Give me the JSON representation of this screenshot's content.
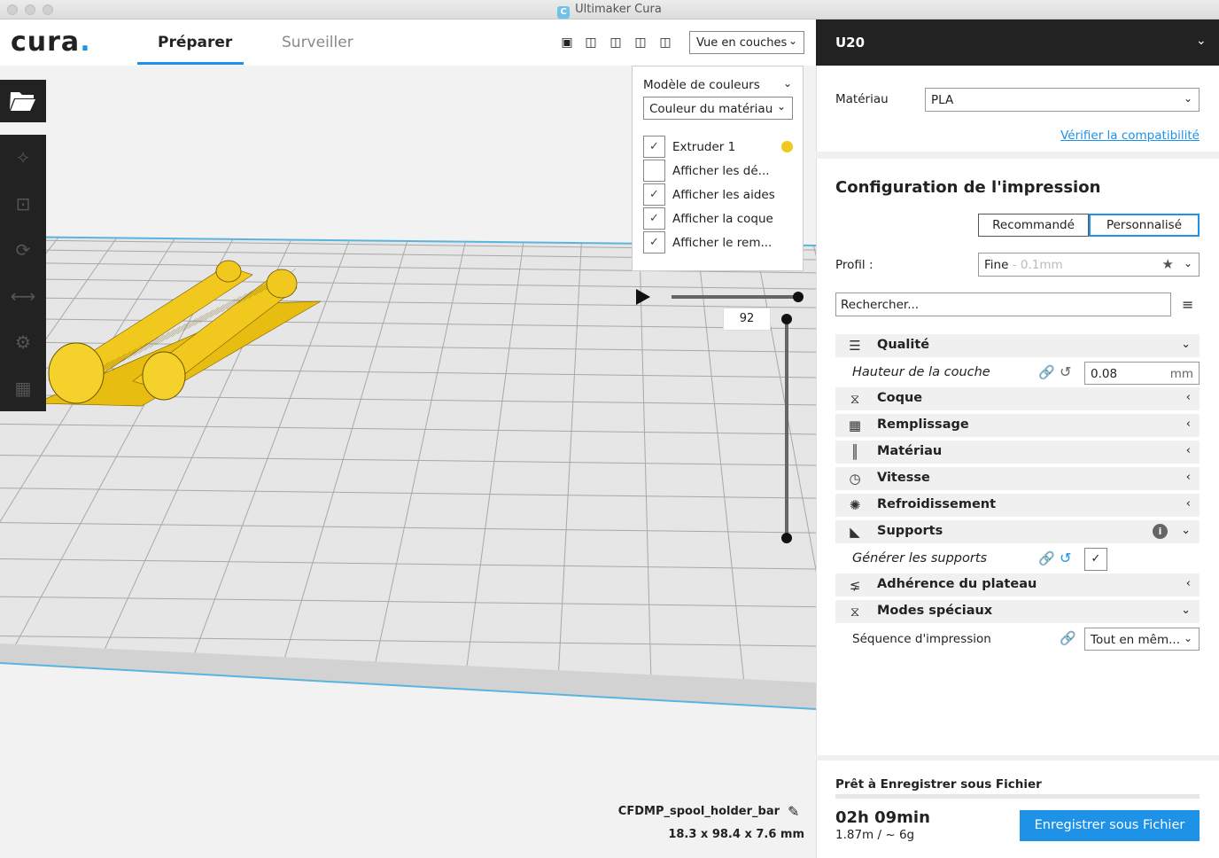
{
  "window": {
    "title": "Ultimaker Cura"
  },
  "header": {
    "logo": "cura",
    "tabs": [
      {
        "label": "Préparer",
        "active": true
      },
      {
        "label": "Surveiller",
        "active": false
      }
    ],
    "view_mode": "Vue en couches",
    "view_icons": [
      "3d-view-icon",
      "front-view-icon",
      "top-view-icon",
      "left-view-icon",
      "right-view-icon"
    ]
  },
  "toolbar": {
    "open_icon": "folder-open-icon",
    "tools": [
      "move-icon",
      "scale-icon",
      "rotate-icon",
      "mirror-icon",
      "per-model-settings-icon",
      "support-blocker-icon"
    ]
  },
  "layer_view": {
    "color_scheme_label": "Modèle de couleurs",
    "color_scheme_value": "Couleur du matériau",
    "options": [
      {
        "label": "Extruder 1",
        "checked": true,
        "swatch": "#f0c81e"
      },
      {
        "label": "Afficher les dé...",
        "checked": false
      },
      {
        "label": "Afficher les aides",
        "checked": true
      },
      {
        "label": "Afficher la coque",
        "checked": true
      },
      {
        "label": "Afficher le rem...",
        "checked": true
      }
    ],
    "current_layer": "92"
  },
  "model": {
    "name": "CFDMP_spool_holder_bar",
    "dimensions": "18.3 x 98.4 x 7.6 mm",
    "color": "#f0c81e"
  },
  "printer": {
    "name": "U20"
  },
  "material": {
    "label": "Matériau",
    "value": "PLA",
    "compat_link": "Vérifier la compatibilité"
  },
  "print_setup": {
    "title": "Configuration de l'impression",
    "mode_recommended": "Recommandé",
    "mode_custom": "Personnalisé",
    "profile_label": "Profil :",
    "profile_value": "Fine",
    "profile_sub": " - 0.1mm",
    "search_placeholder": "Rechercher...",
    "categories": [
      {
        "label": "Qualité",
        "icon": "quality-icon",
        "expanded": true
      },
      {
        "label": "Coque",
        "icon": "shell-icon",
        "expanded": false
      },
      {
        "label": "Remplissage",
        "icon": "infill-icon",
        "expanded": false
      },
      {
        "label": "Matériau",
        "icon": "material-icon",
        "expanded": false
      },
      {
        "label": "Vitesse",
        "icon": "speed-icon",
        "expanded": false
      },
      {
        "label": "Refroidissement",
        "icon": "cooling-icon",
        "expanded": false
      },
      {
        "label": "Supports",
        "icon": "support-icon",
        "expanded": true
      },
      {
        "label": "Adhérence du plateau",
        "icon": "adhesion-icon",
        "expanded": false
      },
      {
        "label": "Modes spéciaux",
        "icon": "special-modes-icon",
        "expanded": true
      }
    ],
    "settings": {
      "layer_height": {
        "label": "Hauteur de la couche",
        "value": "0.08",
        "unit": "mm"
      },
      "generate_support": {
        "label": "Générer les supports",
        "checked": true
      },
      "print_sequence": {
        "label": "Séquence d'impression",
        "value": "Tout en mêm..."
      }
    }
  },
  "output": {
    "status": "Prêt à Enregistrer sous Fichier",
    "time": "02h 09min",
    "usage": "1.87m / ~ 6g",
    "save_button": "Enregistrer sous Fichier"
  },
  "colors": {
    "accent": "#1d92e6",
    "dark": "#222222",
    "model": "#f0c81e"
  }
}
